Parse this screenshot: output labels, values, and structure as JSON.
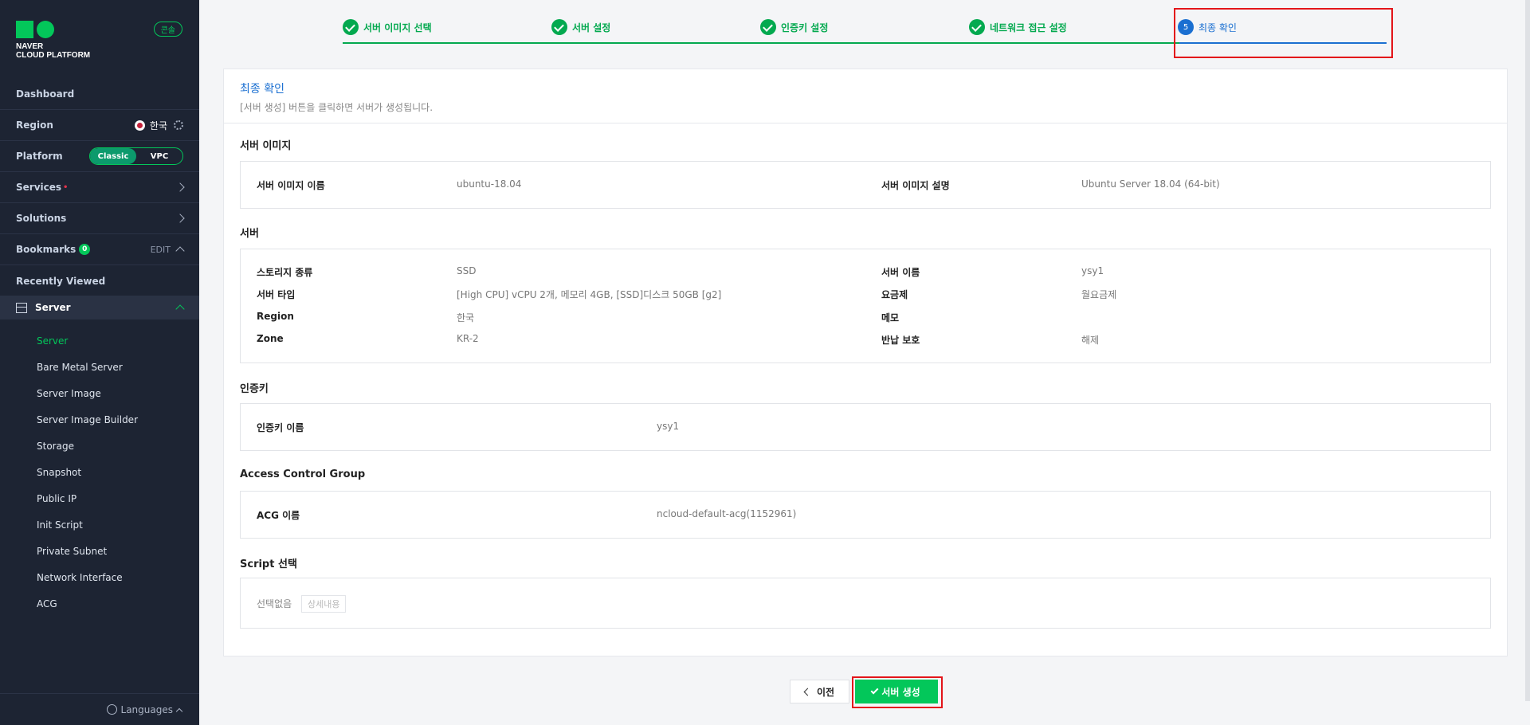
{
  "sidebar": {
    "logo_line1": "NAVER",
    "logo_line2": "CLOUD PLATFORM",
    "badge": "콘솔",
    "dashboard": "Dashboard",
    "region_label": "Region",
    "region_value": "한국",
    "platform_label": "Platform",
    "platform_options": [
      "Classic",
      "VPC"
    ],
    "services": "Services",
    "services_marker": "•",
    "solutions": "Solutions",
    "bookmarks": "Bookmarks",
    "bookmarks_count": "0",
    "edit": "EDIT",
    "recently_viewed": "Recently Viewed",
    "server_group": "Server",
    "sub_items": [
      "Server",
      "Bare Metal Server",
      "Server Image",
      "Server Image Builder",
      "Storage",
      "Snapshot",
      "Public IP",
      "Init Script",
      "Private Subnet",
      "Network Interface",
      "ACG"
    ],
    "languages": "Languages"
  },
  "stepper": {
    "steps": [
      "서버 이미지 선택",
      "서버 설정",
      "인증키 설정",
      "네트워크 접근 설정",
      "최종 확인"
    ],
    "current_number": "5",
    "accent_done": "#03a94f",
    "accent_current": "#1a6fd1"
  },
  "panel": {
    "title": "최종 확인",
    "desc": "[서버 생성] 버튼을 클릭하면 서버가 생성됩니다."
  },
  "sections": {
    "image": {
      "title": "서버 이미지",
      "name_label": "서버 이미지 이름",
      "name_value": "ubuntu-18.04",
      "desc_label": "서버 이미지 설명",
      "desc_value": "Ubuntu Server 18.04 (64-bit)"
    },
    "server": {
      "title": "서버",
      "left": [
        {
          "label": "스토리지 종류",
          "value": "SSD"
        },
        {
          "label": "서버 타입",
          "value": "[High CPU] vCPU 2개, 메모리 4GB, [SSD]디스크 50GB [g2]"
        },
        {
          "label": "Region",
          "value": "한국"
        },
        {
          "label": "Zone",
          "value": "KR-2"
        }
      ],
      "right": [
        {
          "label": "서버 이름",
          "value": "ysy1"
        },
        {
          "label": "요금제",
          "value": "월요금제"
        },
        {
          "label": "메모",
          "value": ""
        },
        {
          "label": "반납 보호",
          "value": "해제"
        }
      ]
    },
    "auth": {
      "title": "인증키",
      "label": "인증키 이름",
      "value": "ysy1"
    },
    "acg": {
      "title": "Access Control Group",
      "label": "ACG 이름",
      "value": "ncloud-default-acg(1152961)"
    },
    "script": {
      "title": "Script 선택",
      "value": "선택없음",
      "detail": "상세내용"
    }
  },
  "buttons": {
    "prev": "이전",
    "create": "서버 생성",
    "create_color": "#03c75a"
  }
}
